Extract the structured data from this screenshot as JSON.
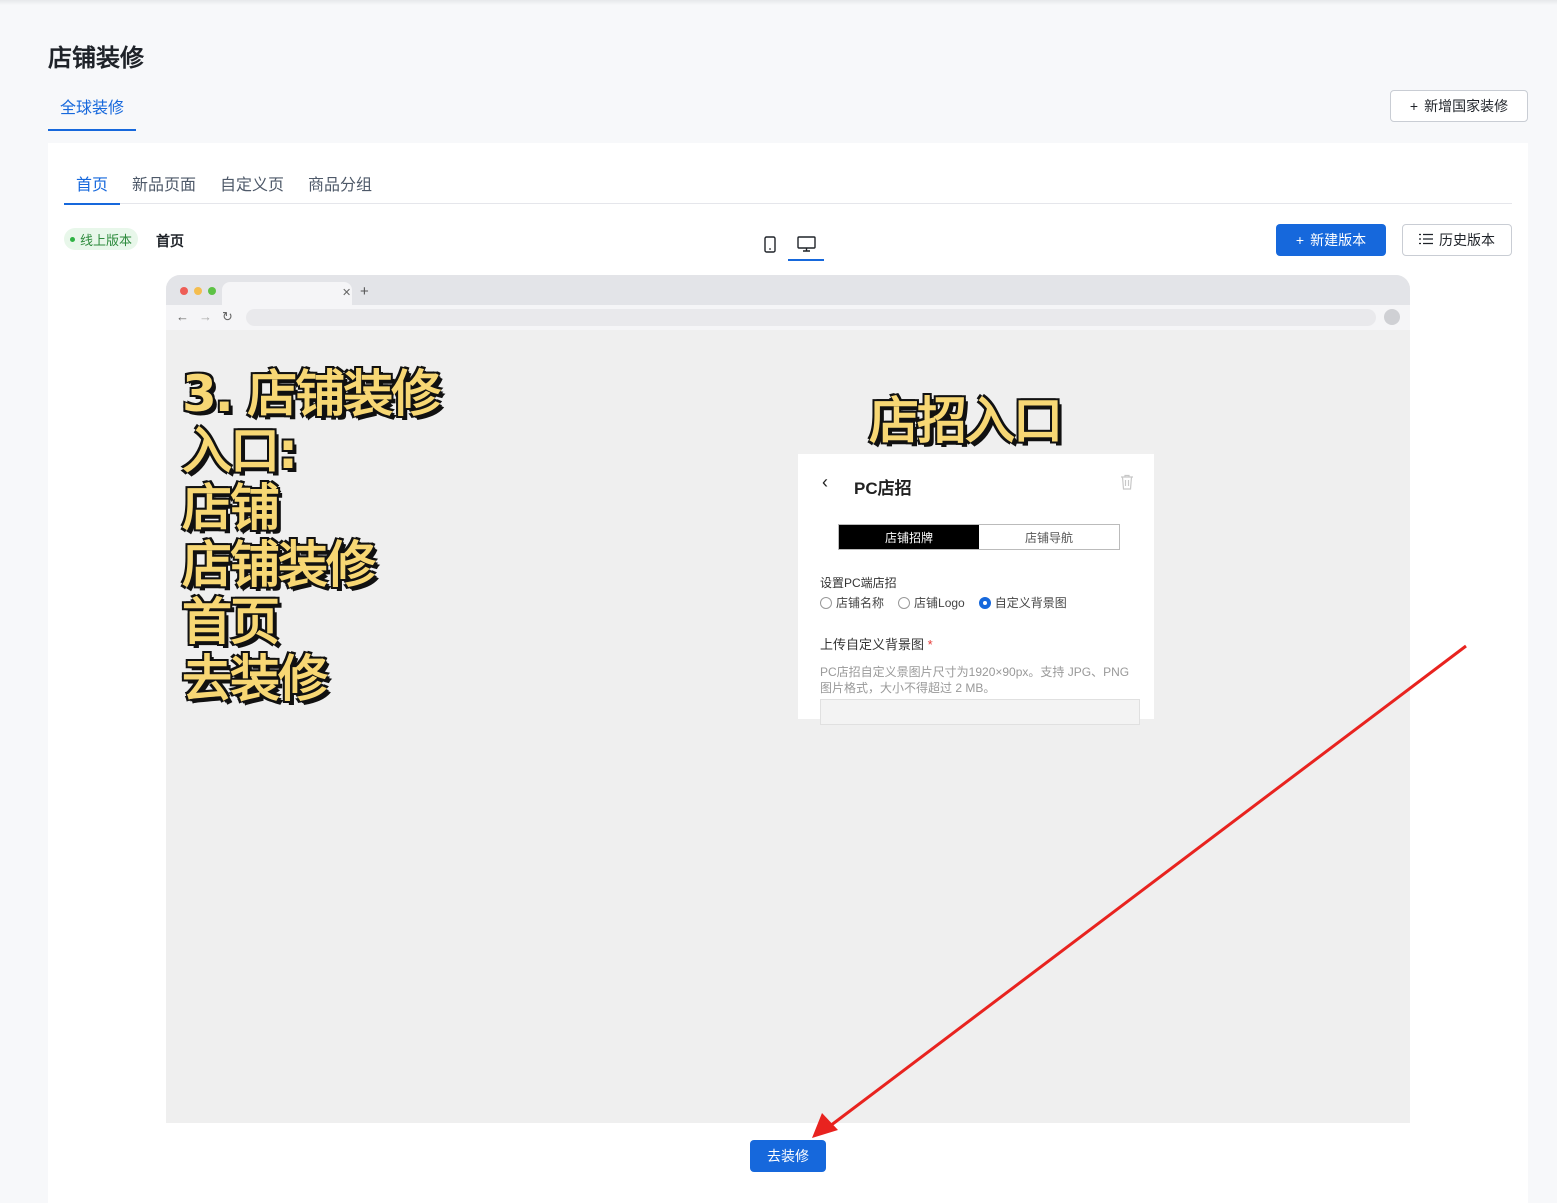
{
  "page": {
    "title": "店铺装修"
  },
  "header": {
    "global_tab": "全球装修",
    "add_country_button": "新增国家装修"
  },
  "tabs": [
    {
      "label": "首页",
      "active": true
    },
    {
      "label": "新品页面",
      "active": false
    },
    {
      "label": "自定义页",
      "active": false
    },
    {
      "label": "商品分组",
      "active": false
    }
  ],
  "toolbar": {
    "status_badge": "线上版本",
    "version_name": "首页",
    "device_options": [
      "mobile-icon",
      "desktop-icon"
    ],
    "selected_device": "desktop",
    "new_version_button": "新建版本",
    "history_button": "历史版本"
  },
  "preview": {
    "overlay_text": "3. 店铺装修\n入口:\n店铺\n店铺装修\n首页\n去装修",
    "panel_heading": "店招入口",
    "panel": {
      "title": "PC店招",
      "segments": [
        "店铺招牌",
        "店铺导航"
      ],
      "active_segment": "店铺招牌",
      "setting_label": "设置PC端店招",
      "options": [
        "店铺名称",
        "店铺Logo",
        "自定义背景图"
      ],
      "selected_option": "自定义背景图",
      "upload_label": "上传自定义背景图",
      "required_mark": "*",
      "hint": "PC店招自定义景图片尺寸为1920×90px。支持 JPG、PNG 图片格式，大小不得超过 2 MB。"
    }
  },
  "actions": {
    "go_decorate_button": "去装修"
  },
  "colors": {
    "accent": "#1668dc",
    "annotation_arrow": "#e8231f",
    "overlay_text": "#f7d774"
  }
}
